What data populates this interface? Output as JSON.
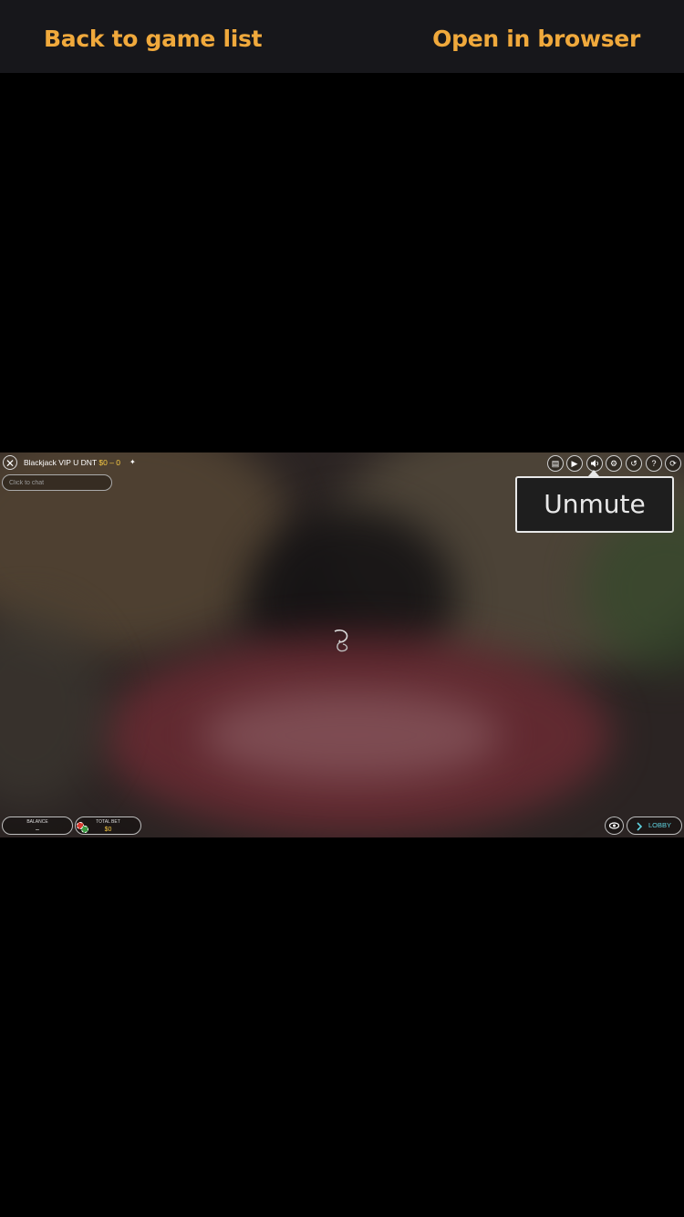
{
  "topbar": {
    "back_label": "Back to game list",
    "open_label": "Open in browser",
    "accent_color": "#f0a93c"
  },
  "game": {
    "table_name": "Blackjack VIP U DNT",
    "table_limits": "$0 – 0",
    "chat_placeholder": "Click to chat",
    "controls": [
      "chat-icon",
      "video-icon",
      "sound-icon",
      "settings-icon",
      "history-icon",
      "help-icon",
      "fullscreen-icon"
    ],
    "tooltip": "Unmute",
    "balance": {
      "label": "BALANCE",
      "value": "–"
    },
    "total_bet": {
      "label": "TOTAL BET",
      "value": "$0"
    },
    "lobby_label": "LOBBY"
  }
}
